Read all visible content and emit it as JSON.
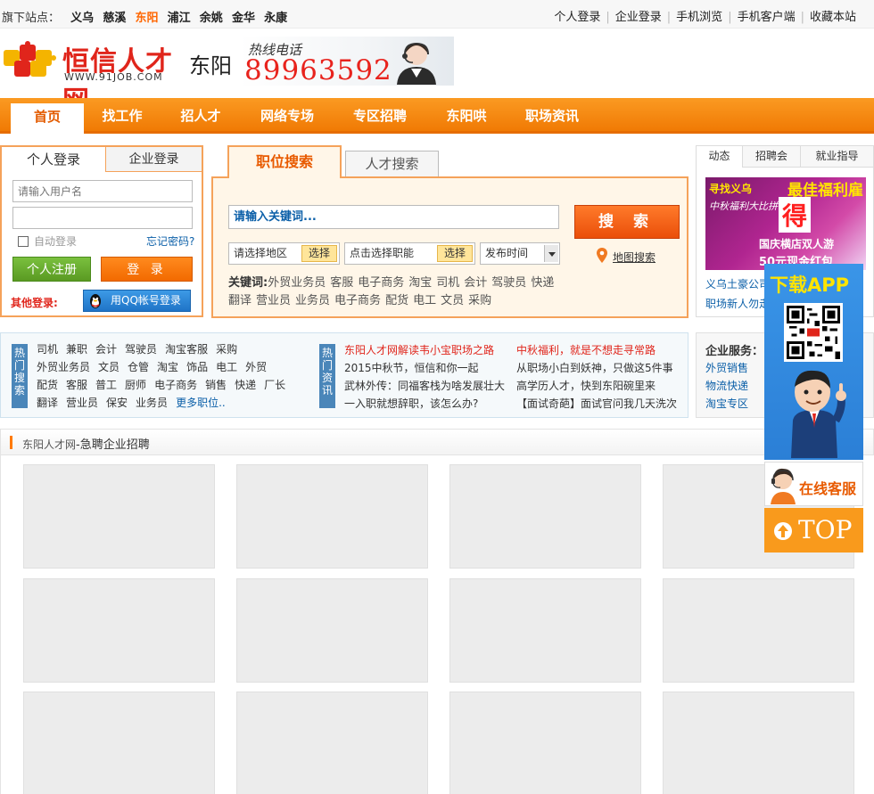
{
  "topbar": {
    "label": "旗下站点：",
    "sites": [
      {
        "name": "义乌",
        "active": false
      },
      {
        "name": "慈溪",
        "active": false
      },
      {
        "name": "东阳",
        "active": true
      },
      {
        "name": "浦江",
        "active": false
      },
      {
        "name": "余姚",
        "active": false
      },
      {
        "name": "金华",
        "active": false
      },
      {
        "name": "永康",
        "active": false
      }
    ],
    "links": [
      "个人登录",
      "企业登录",
      "手机浏览",
      "手机客户端",
      "收藏本站"
    ]
  },
  "header": {
    "logo_name": "恒信人才网",
    "logo_url": "WWW.91JOB.COM",
    "city": "东阳",
    "hotline_label": "热线电话",
    "hotline_number": "89963592"
  },
  "nav": {
    "items": [
      "首页",
      "找工作",
      "招人才",
      "网络专场",
      "专区招聘",
      "东阳哄",
      "职场资讯"
    ],
    "active_index": 0
  },
  "login": {
    "tab_personal": "个人登录",
    "tab_company": "企业登录",
    "username_placeholder": "请输入用户名",
    "password_value": "",
    "auto_login": "自动登录",
    "forgot": "忘记密码?",
    "register": "个人注册",
    "login_btn": "登 录",
    "other_login": "其他登录:",
    "qq_login": "用QQ帐号登录"
  },
  "search": {
    "tab_job": "职位搜索",
    "tab_talent": "人才搜索",
    "keyword_placeholder": "请输入关键词...",
    "search_btn": "搜 索",
    "area_placeholder": "请选择地区",
    "func_placeholder": "点击选择职能",
    "pick": "选择",
    "time_select": "发布时间",
    "map_search": "地图搜索",
    "keywords_label": "关键词:",
    "keywords": [
      "外贸业务员",
      "客服",
      "电子商务",
      "淘宝",
      "司机",
      "会计",
      "驾驶员",
      "快递",
      "翻译",
      "营业员",
      "业务员",
      "电子商务",
      "配货",
      "电工",
      "文员",
      "采购"
    ]
  },
  "news": {
    "tabs": [
      "动态",
      "招聘会",
      "就业指导"
    ],
    "ad": {
      "line1": "寻找义乌",
      "line2": "最佳福利雇主",
      "line3": "中秋福利大比拼",
      "big": "得",
      "line4": "国庆横店双人游",
      "line5": "50元现金红包"
    },
    "links": [
      "义乌土豪公司",
      "职场新人勿走"
    ]
  },
  "hot": {
    "search_label": "热门搜索",
    "tags": [
      "司机",
      "兼职",
      "会计",
      "驾驶员",
      "淘宝客服",
      "采购",
      "外贸业务员",
      "文员",
      "仓管",
      "淘宝",
      "饰品",
      "电工",
      "外贸",
      "配货",
      "客服",
      "普工",
      "厨师",
      "电子商务",
      "销售",
      "快递",
      "厂长",
      "翻译",
      "营业员",
      "保安",
      "业务员"
    ],
    "more": "更多职位..",
    "news_label": "热门资讯",
    "news": [
      {
        "text": "东阳人才网解读韦小宝职场之路",
        "red": true
      },
      {
        "text": "中秋福利，就是不想走寻常路",
        "red": true
      },
      {
        "text": "2015中秋节，恒信和你一起",
        "red": false
      },
      {
        "text": "从职场小白到妖神，只做这5件事",
        "red": false
      },
      {
        "text": "武林外传：同福客栈为啥发展壮大",
        "red": false
      },
      {
        "text": "高学历人才，快到东阳碗里来",
        "red": false
      },
      {
        "text": "一入职就想辞职，该怎么办?",
        "red": false
      },
      {
        "text": "【面试奇葩】面试官问我几天洗次",
        "red": false
      }
    ]
  },
  "service": {
    "title": "企业服务：",
    "links": [
      "外贸销售",
      "物流快递",
      "淘宝专区"
    ]
  },
  "urgent": {
    "site": "东阳人才网",
    "title": "-急聘企业招聘"
  },
  "float": {
    "app": "下载APP",
    "service": "在线客服",
    "top": "TOP"
  },
  "colors": {
    "accent": "#f07a04",
    "link": "#0b5fa8",
    "red": "#e0251b"
  }
}
